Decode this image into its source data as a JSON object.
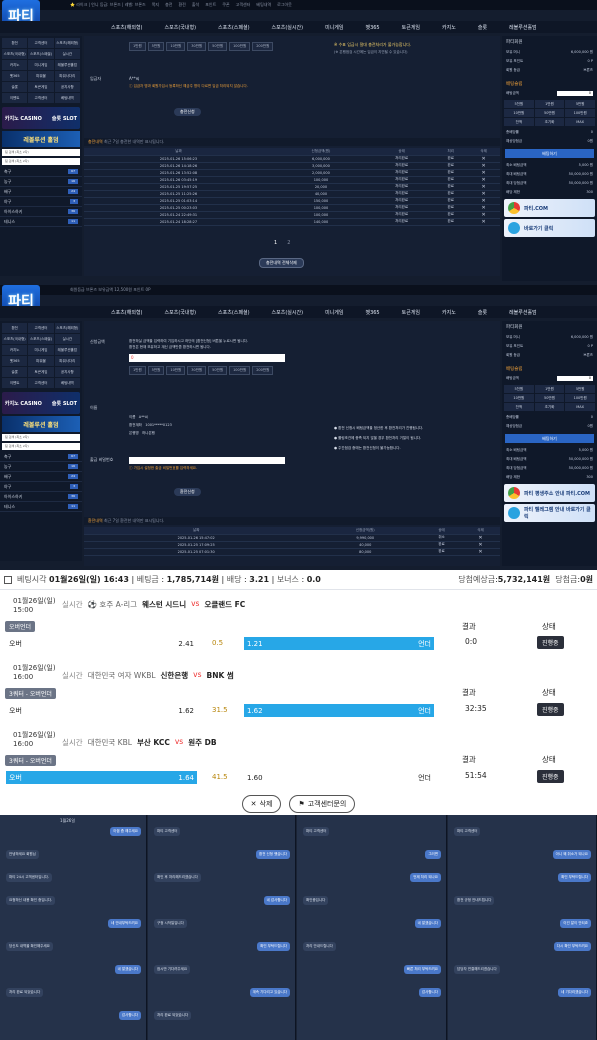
{
  "screen1": {
    "top_bar": [
      "⭐ 라이크 | 언니 등급: 브론즈 | 레벨: 브론즈",
      "쪽지",
      "충전",
      "환전",
      "출석",
      "포인트",
      "쿠폰",
      "고객센터",
      "베팅내역",
      "로그아웃"
    ],
    "logo": "파티",
    "nav": [
      "스포츠(해외형)",
      "스포츠(국내형)",
      "스포츠(스페셜)",
      "스포츠(실시간)",
      "미니게임",
      "벳365",
      "토큰게임",
      "카지노",
      "슬롯",
      "레볼루션홀덤"
    ],
    "sidebar_grid": [
      "환전",
      "고객센터",
      "스포츠(해외형)",
      "스포츠(국내형)",
      "스포츠(스페셜)",
      "실시간",
      "카지노",
      "미니게임",
      "레볼루션홀덤",
      "벳365",
      "파워볼",
      "파워사다리",
      "슬롯",
      "토큰게임",
      "공지사항",
      "이벤트",
      "고객센터",
      "베팅내역"
    ],
    "banner_casino": "카지노 CASINO",
    "banner_slot": "슬롯 SLOT",
    "banner_holdem": "레볼루션 홀덤",
    "search_placeholder": "팀 검색 (최소 2자)",
    "sports_list": [
      {
        "name": "축구",
        "count": "67"
      },
      {
        "name": "농구",
        "count": "16"
      },
      {
        "name": "배구",
        "count": "24"
      },
      {
        "name": "야구",
        "count": "3"
      },
      {
        "name": "아이스하키",
        "count": "36"
      },
      {
        "name": "테니스",
        "count": "11"
      }
    ],
    "amount_buttons": [
      "1만원",
      "5만원",
      "10만원",
      "30만원",
      "50만원",
      "100만원",
      "200만원"
    ],
    "deposit_name_label": "입금자",
    "deposit_name_value": "A**씨",
    "notice_text": "ⓘ 입금자 명과 회원가입시 등록하신 예금주 명이 다르면 입금 처리되지 않습니다.",
    "apply_button": "충전신청",
    "warning_title": "※ 수표 입금시 절대 충전처리가 불가능합니다.",
    "warning_sub": "(※ 은행점검 시간에는 입금이 지연될 수 있습니다)",
    "history_title": "충전내역",
    "history_sub": "최근 7일 충전한 내역만 표시됩니다.",
    "history_cols": [
      "날짜",
      "신청금액(원)",
      "상태",
      "처리",
      "삭제"
    ],
    "history_rows": [
      [
        "2025-01-26 15:06:23",
        "6,000,000",
        "처리완료",
        "완료",
        "✕"
      ],
      [
        "2025-01-26 14:18:26",
        "3,000,000",
        "처리완료",
        "완료",
        "✕"
      ],
      [
        "2025-01-26 13:52:08",
        "2,000,000",
        "처리완료",
        "완료",
        "✕"
      ],
      [
        "2025-01-26 03:45:19",
        "100,000",
        "처리완료",
        "완료",
        "✕"
      ],
      [
        "2025-01-25 19:57:25",
        "20,000",
        "처리완료",
        "완료",
        "✕"
      ],
      [
        "2025-01-25 11:25:26",
        "40,000",
        "처리완료",
        "완료",
        "✕"
      ],
      [
        "2025-01-25 01:03:14",
        "150,000",
        "처리완료",
        "완료",
        "✕"
      ],
      [
        "2025-01-25 00:23:03",
        "100,000",
        "처리완료",
        "완료",
        "✕"
      ],
      [
        "2025-01-24 22:49:31",
        "100,000",
        "처리완료",
        "완료",
        "✕"
      ],
      [
        "2025-01-24 18:28:27",
        "140,000",
        "처리완료",
        "완료",
        "✕"
      ]
    ],
    "pages": [
      "1",
      "2"
    ],
    "delete_all": "충전내역 전체삭제",
    "right_panel": {
      "user": "파티회원",
      "rows": [
        [
          "보유 머니",
          "6,000,000 원"
        ],
        [
          "보유 포인트",
          "0 P"
        ],
        [
          "회원 등급",
          "브론즈"
        ]
      ],
      "slip_title": "배팅슬립",
      "amount_label": "배팅금액",
      "amount_value": "0",
      "quick": [
        "5천원",
        "1만원",
        "5만원",
        "10만원",
        "50만원",
        "100만원",
        "잔액",
        "초기화",
        "MAX"
      ],
      "total_odds_label": "총배당률",
      "total_odds": "0",
      "expected_label": "예상당첨금",
      "expected": "0원",
      "bet_button": "배팅하기",
      "limits": [
        [
          "최소 배팅금액",
          "5,000 원"
        ],
        [
          "최대 배팅금액",
          "50,000,000 원"
        ],
        [
          "최대 당첨금액",
          "50,000,000 원"
        ],
        [
          "배당 제한",
          "300"
        ]
      ],
      "promo1": "파티.COM",
      "promo2": "바로가기 클릭"
    }
  },
  "screen2": {
    "top_bar": "회원등급 브론즈 보유금액 12,500원 포인트 0P",
    "notice1": "환전하실 금액을 입력하여 기입하시고 하단의 [환전신청] 버튼을 누르시면 됩니다.",
    "notice2": "환전은 현재 보유하고 계신 금액만큼 환전하시면 됩니다.",
    "amount_label": "신청금액",
    "amount_value": "0",
    "bank_name_label": "이름",
    "bank_name": "A**씨",
    "account_label": "환전계좌",
    "account": "1001*****0123",
    "bank_label": "은행명",
    "bank": "하나은행",
    "pw_label": "출금 비밀번호",
    "pw_notice": "ⓘ 가입시 설정한 출금 비밀번호를 입력하세요.",
    "apply_button": "환전신청",
    "rules": [
      "● 환전 신청시 베팅금액을 정산한 후 환전처리가 진행됩니다.",
      "● 롤링조건에 충족 되지 않을 경우 환전처리 거절이 됩니다.",
      "● 주간점검 중에는 환전신청이 불가능합니다."
    ],
    "history_title": "환전내역",
    "history_sub": "최근 7일 환전한 내역만 표시됩니다.",
    "history_cols": [
      "날짜",
      "신청금액(원)",
      "상태",
      "삭제"
    ],
    "history_rows": [
      [
        "2025-01-26 15:47:02",
        "9,990,000",
        "취소",
        "✕"
      ],
      [
        "2025-01-25 17:09:25",
        "40,000",
        "완료",
        "✕"
      ],
      [
        "2025-01-25 07:01:30",
        "80,000",
        "완료",
        "✕"
      ]
    ],
    "promo1": "파티 평생주소 안내 파티.COM",
    "promo2": "파티 텔레그램 안내 바로가기 클릭"
  },
  "bet": {
    "summary": {
      "label": "베팅시각",
      "time": "01월26일(일) 16:43",
      "amount_label": "베팅금",
      "amount": "1,785,714원",
      "odds_label": "배당",
      "odds": "3.21",
      "bonus_label": "보너스",
      "bonus": "0.0",
      "expected_label": "당첨예상금",
      "expected": "5,732,141원",
      "won_label": "당첨금",
      "won": "0원"
    },
    "games": [
      {
        "date": "01월26일(일)",
        "time": "15:00",
        "live": "실시간",
        "league": "⚽ 호주 A-리그",
        "home": "웨스턴 시드니",
        "away": "오클랜드 FC",
        "market": "오버언더",
        "pick_label": "오버",
        "over": "2.41",
        "line": "0.5",
        "under": "1.21",
        "selected": "언더",
        "result_label": "결과",
        "result": "0:0",
        "state_label": "상태",
        "state": "진행중"
      },
      {
        "date": "01월26일(일)",
        "time": "16:00",
        "live": "실시간",
        "league": "대한민국 여자 WKBL",
        "home": "신한은행",
        "away": "BNK 썸",
        "market": "3쿼터 - 오버언더",
        "pick_label": "오버",
        "over": "1.62",
        "line": "31.5",
        "under": "1.62",
        "selected": "언더",
        "result_label": "결과",
        "result": "32:35",
        "state_label": "상태",
        "state": "진행중"
      },
      {
        "date": "01월26일(일)",
        "time": "16:00",
        "live": "실시간",
        "league": "대한민국 KBL",
        "home": "부산 KCC",
        "away": "원주 DB",
        "market": "3쿼터 - 오버언더",
        "pick_label": "오버",
        "over": "1.64",
        "line": "41.5",
        "under": "1.60",
        "selected": "언더",
        "result_label": "결과",
        "result": "51:54",
        "state_label": "상태",
        "state": "진행중"
      }
    ],
    "delete_button": "삭제",
    "support_button": "고객센터문의"
  },
  "chat": {
    "date": "1월26일",
    "col1": [
      {
        "t": "아꼽 좀 해주세요",
        "o": true
      },
      {
        "t": "안녕하세요 회원님",
        "o": false
      },
      {
        "t": "파티 24시 고객센터입니다.",
        "o": false
      },
      {
        "t": "요청하신 내용 확인 중입니다.",
        "o": false
      },
      {
        "t": "네 안내부탁드려요",
        "o": true
      },
      {
        "t": "당신도 내역을 확인해주세요",
        "o": false
      },
      {
        "t": "네 알겠습니다",
        "o": true
      },
      {
        "t": "처리 완료 되었습니다",
        "o": false
      },
      {
        "t": "감사합니다",
        "o": true
      }
    ],
    "col2": [
      {
        "t": "파티 고객센터",
        "o": false
      },
      {
        "t": "환전 신청 했습니다",
        "o": true
      },
      {
        "t": "확인 후 처리해드리겠습니다",
        "o": false
      },
      {
        "t": "네 감사합니다",
        "o": true
      },
      {
        "t": "구정 시작일입니다",
        "o": false
      },
      {
        "t": "확인 부탁드립니다",
        "o": true
      },
      {
        "t": "잠시만 기다려주세요",
        "o": false
      },
      {
        "t": "계속 기다리고 있습니다",
        "o": true
      },
      {
        "t": "처리 완료 되었습니다",
        "o": false
      }
    ],
    "col3": [
      {
        "t": "파티 고객센터",
        "o": false
      },
      {
        "t": "그러면",
        "o": true
      },
      {
        "t": "언제 처리 되나요",
        "o": true
      },
      {
        "t": "확인중입니다",
        "o": false
      },
      {
        "t": "네 알겠습니다",
        "o": true
      },
      {
        "t": "처리 안내드립니다",
        "o": false
      },
      {
        "t": "빠른 처리 부탁드려요",
        "o": true
      },
      {
        "t": "감사합니다",
        "o": true
      }
    ],
    "col4": [
      {
        "t": "파티 고객센터",
        "o": false
      },
      {
        "t": "아니 왜 취소가 되나요",
        "o": true
      },
      {
        "t": "확인 부탁드립니다",
        "o": true
      },
      {
        "t": "환전 규정 안내드립니다",
        "o": false
      },
      {
        "t": "이건 말이 안되죠",
        "o": true
      },
      {
        "t": "다시 확인 부탁드려요",
        "o": true
      },
      {
        "t": "담당자 연결해드리겠습니다",
        "o": false
      },
      {
        "t": "네 기다리겠습니다",
        "o": true
      }
    ]
  }
}
